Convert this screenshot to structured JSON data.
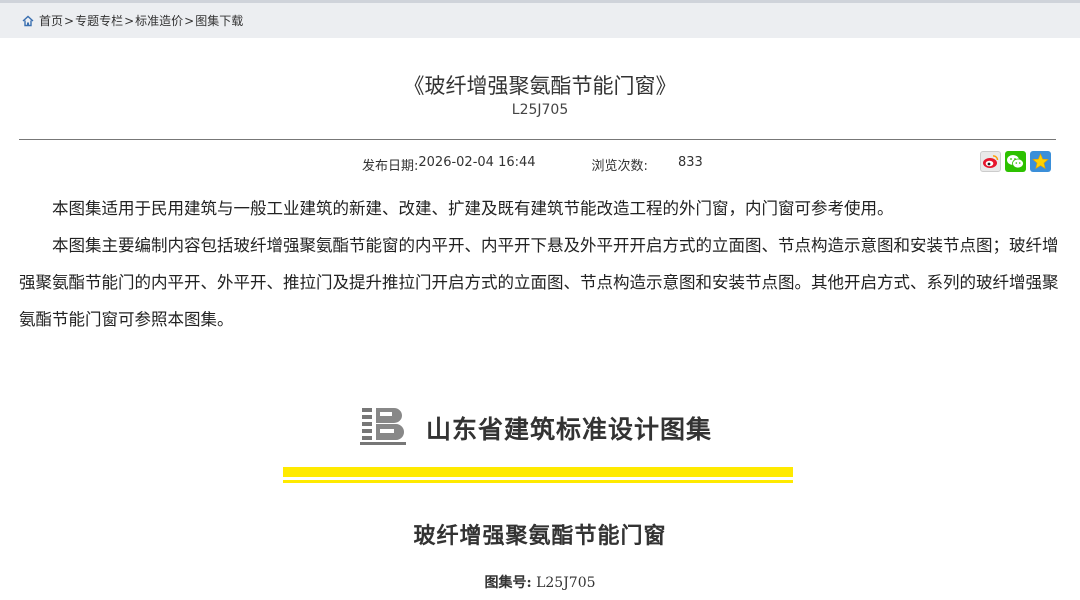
{
  "breadcrumb": {
    "items": [
      "首页",
      "专题专栏",
      "标准造价",
      "图集下载"
    ],
    "separator": ">"
  },
  "article": {
    "title": "《玻纤增强聚氨酯节能门窗》",
    "code": "L25J705",
    "publish_label": "发布日期:",
    "publish_date": "2026-02-04 16:44",
    "views_label": "浏览次数:",
    "views_value": "833",
    "paragraphs": [
      "本图集适用于民用建筑与一般工业建筑的新建、改建、扩建及既有建筑节能改造工程的外门窗，内门窗可参考使用。",
      "本图集主要编制内容包括玻纤增强聚氨酯节能窗的内平开、内平开下悬及外平开开启方式的立面图、节点构造示意图和安装节点图；玻纤增强聚氨酯节能门的内平开、外平开、推拉门及提升推拉门开启方式的立面图、节点构造示意图和安装节点图。其他开启方式、系列的玻纤增强聚氨酯节能门窗可参照本图集。"
    ]
  },
  "share": {
    "icons": [
      "weibo-icon",
      "wechat-icon",
      "favorite-star-icon"
    ]
  },
  "cover": {
    "organization": "山东省建筑标准设计图集",
    "title": "玻纤增强聚氨酯节能门窗",
    "code_label": "图集号:",
    "code_value": "L25J705",
    "accent_color": "#ffea00"
  }
}
